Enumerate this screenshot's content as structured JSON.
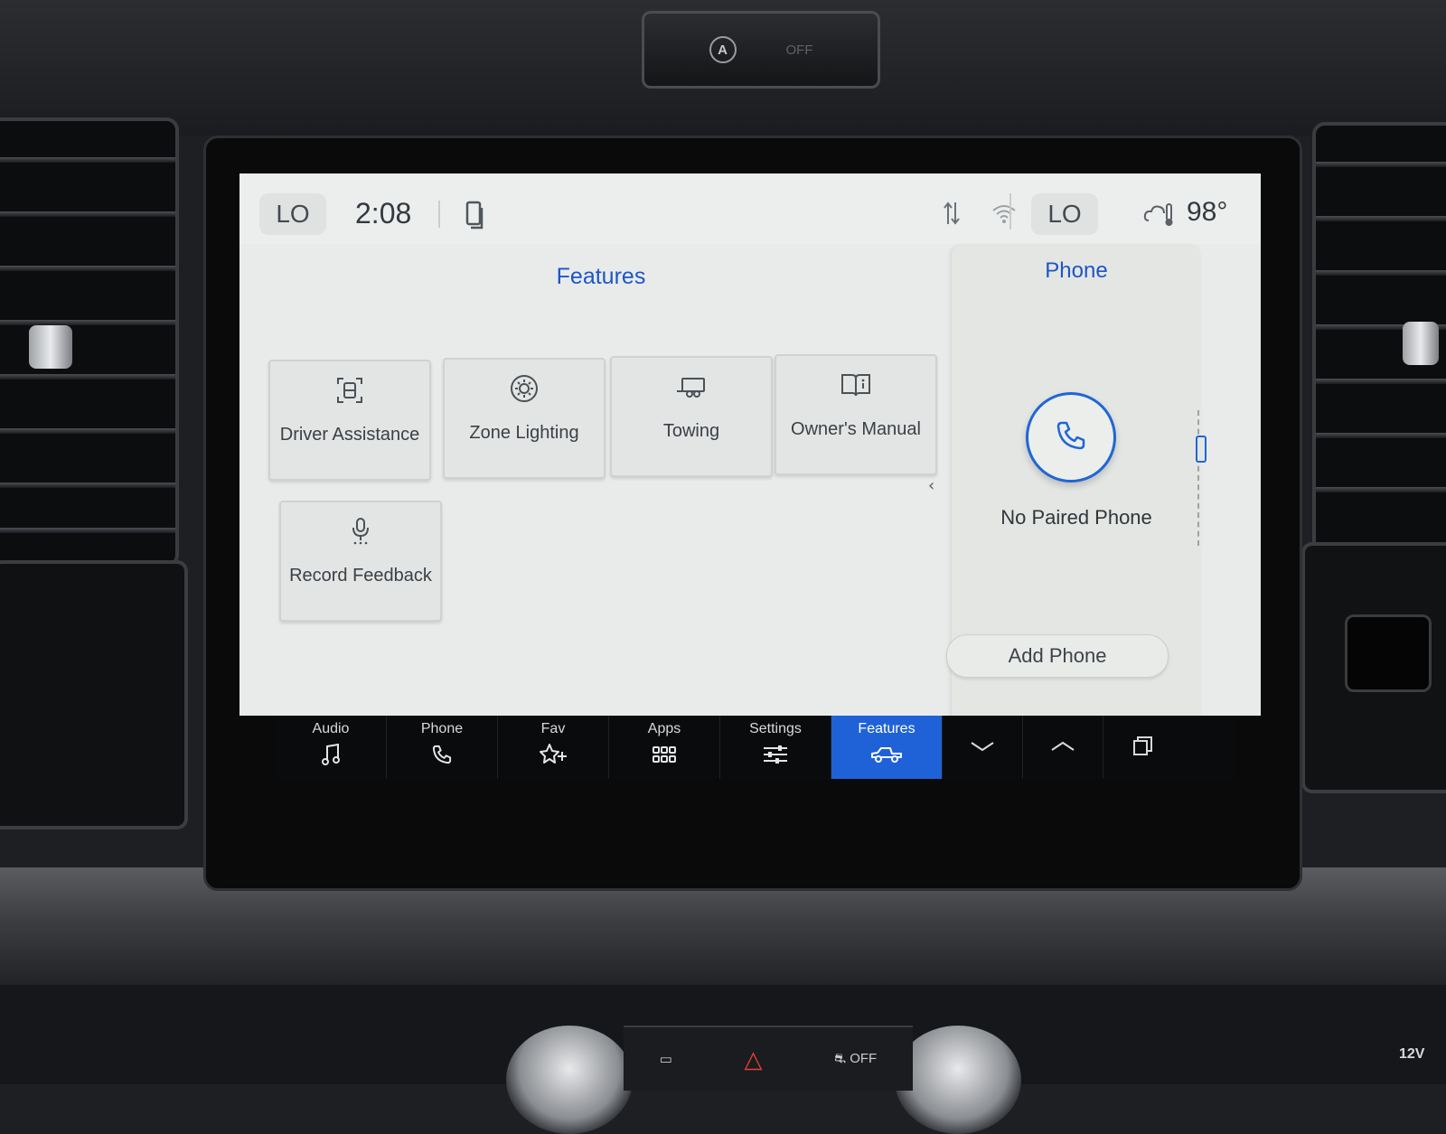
{
  "status_bar": {
    "left_temp": "LO",
    "time": "2:08",
    "right_temp": "LO",
    "outside_temp": "98°"
  },
  "features": {
    "title": "Features",
    "tiles": [
      {
        "label": "Driver Assistance",
        "icon": "driver-assist-icon"
      },
      {
        "label": "Zone Lighting",
        "icon": "zone-lighting-icon"
      },
      {
        "label": "Towing",
        "icon": "trailer-icon"
      },
      {
        "label": "Owner's Manual",
        "icon": "manual-book-icon"
      },
      {
        "label": "Record Feedback",
        "icon": "microphone-icon"
      }
    ]
  },
  "phone_panel": {
    "title": "Phone",
    "status": "No Paired Phone",
    "add_button": "Add Phone"
  },
  "nav": {
    "items": [
      {
        "label": "Audio",
        "icon": "music-note-icon"
      },
      {
        "label": "Phone",
        "icon": "phone-icon"
      },
      {
        "label": "Fav",
        "icon": "star-add-icon"
      },
      {
        "label": "Apps",
        "icon": "apps-grid-icon"
      },
      {
        "label": "Settings",
        "icon": "sliders-icon"
      },
      {
        "label": "Features",
        "icon": "truck-icon",
        "active": true
      }
    ]
  },
  "hardware": {
    "auto_off": "OFF",
    "traction_off": "OFF",
    "outlet": "12V"
  },
  "colors": {
    "accent": "#1f62d8",
    "title_blue": "#1c56c8",
    "screen_bg": "#e9ebea"
  }
}
